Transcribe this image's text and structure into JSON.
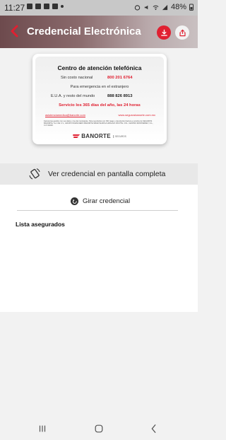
{
  "status_bar": {
    "time": "11:27",
    "battery": "48%"
  },
  "header": {
    "title": "Credencial Electrónica"
  },
  "card": {
    "title": "Centro de atención telefónica",
    "line1_label": "Sin costo nacional",
    "line1_number": "800 201 6764",
    "line2_label": "Para emergencia en el extranjero",
    "line3_label": "E.U.A. y resto del mundo",
    "line3_number": "888 826 8913",
    "service": "Servicio los 365 días del año, las 24 horas",
    "email": "asistenciamedica@banorte.com",
    "website": "www.segurosbanorte.com.mx",
    "legal": "Factura las gestión con sus datos y los del contratante. Para reembolso con SIN (pago y devolución) factura a nombre de SEGUROS BANORTE, S.A. DE C.V., GRUPO FINANCIERO BANORTE SBG971124PL2 HIDALGO 250 PTE. COL. CENTRO MONTERREY, N.L., C.P. 64000.",
    "logo_text": "BANORTE",
    "logo_sub": "SEGUROS",
    "brand_color": "#e02031"
  },
  "fullscreen_label": "Ver credencial en pantalla completa",
  "rotate_label": "Girar credencial",
  "list_title": "Lista asegurados"
}
